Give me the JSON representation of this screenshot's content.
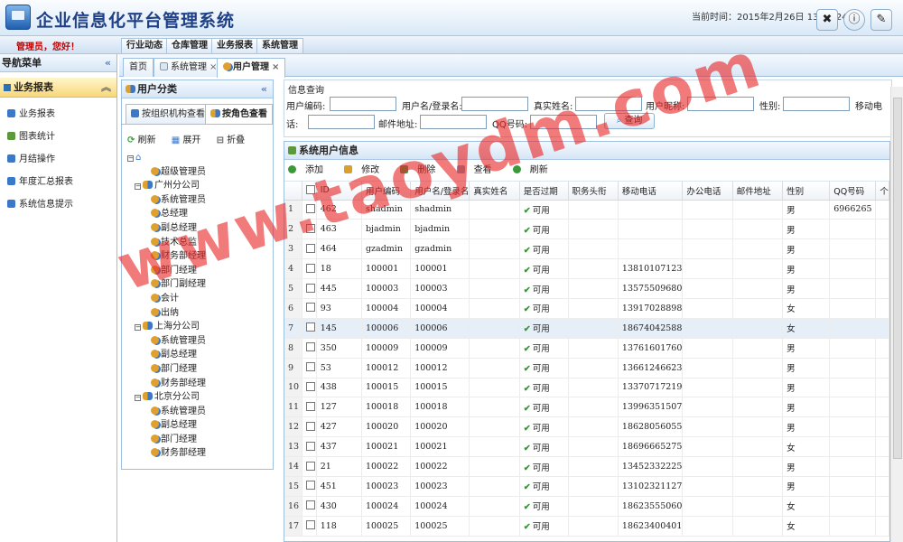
{
  "header": {
    "title": "企业信息化平台管理系统",
    "time_label": "当前时间：2015年2月26日 13:00:24",
    "buttons": [
      {
        "icon": "tools-icon",
        "glyph": "✖"
      },
      {
        "icon": "help-icon",
        "glyph": "ⓘ"
      },
      {
        "icon": "logout-icon",
        "glyph": "✎"
      }
    ]
  },
  "topnav": {
    "welcome": "管理员，您好！",
    "items": [
      "行业动态",
      "仓库管理",
      "业务报表",
      "系统管理"
    ]
  },
  "sidebar": {
    "title": "导航菜单",
    "section": "业务报表",
    "items": [
      "业务报表",
      "图表统计",
      "月结操作",
      "年度汇总报表",
      "系统信息提示"
    ]
  },
  "tabs": [
    {
      "label": "首页"
    },
    {
      "label": "系统管理",
      "close": "×"
    },
    {
      "label": "用户管理",
      "close": "×"
    }
  ],
  "user_panel": {
    "title": "用户分类",
    "tab_org": "按组织机构查看",
    "tab_role": "按角色查看",
    "toolbar": [
      "刷新",
      "展开",
      "折叠"
    ],
    "tree": {
      "root_icon": "⌂",
      "items": [
        {
          "label": "超级管理员",
          "level": 1,
          "type": "user"
        },
        {
          "label": "广州分公司",
          "level": 0,
          "type": "group"
        },
        {
          "label": "系统管理员",
          "level": 1,
          "type": "user"
        },
        {
          "label": "总经理",
          "level": 1,
          "type": "user"
        },
        {
          "label": "副总经理",
          "level": 1,
          "type": "user"
        },
        {
          "label": "技术总监",
          "level": 1,
          "type": "user"
        },
        {
          "label": "财务部经理",
          "level": 1,
          "type": "user"
        },
        {
          "label": "部门经理",
          "level": 1,
          "type": "user"
        },
        {
          "label": "部门副经理",
          "level": 1,
          "type": "user"
        },
        {
          "label": "会计",
          "level": 1,
          "type": "user"
        },
        {
          "label": "出纳",
          "level": 1,
          "type": "user"
        },
        {
          "label": "上海分公司",
          "level": 0,
          "type": "group"
        },
        {
          "label": "系统管理员",
          "level": 1,
          "type": "user"
        },
        {
          "label": "副总经理",
          "level": 1,
          "type": "user"
        },
        {
          "label": "部门经理",
          "level": 1,
          "type": "user"
        },
        {
          "label": "财务部经理",
          "level": 1,
          "type": "user"
        },
        {
          "label": "北京分公司",
          "level": 0,
          "type": "group"
        },
        {
          "label": "系统管理员",
          "level": 1,
          "type": "user"
        },
        {
          "label": "副总经理",
          "level": 1,
          "type": "user"
        },
        {
          "label": "部门经理",
          "level": 1,
          "type": "user"
        },
        {
          "label": "财务部经理",
          "level": 1,
          "type": "user"
        }
      ]
    }
  },
  "query": {
    "legend": "信息查询",
    "labels": {
      "user_code": "用户编码:",
      "login_name": "用户名/登录名:",
      "real_name": "真实姓名:",
      "nickname": "用户昵称:",
      "gender": "性别:",
      "mobile_a": "移动电",
      "mobile_b": "话:",
      "email": "邮件地址:",
      "qq": "QQ号码:"
    },
    "search_button": "查询"
  },
  "grid": {
    "title": "系统用户信息",
    "toolbar": [
      "添加",
      "修改",
      "删除",
      "查看",
      "刷新"
    ],
    "columns": [
      "ID",
      "用户编码",
      "用户名/登录名",
      "真实姓名",
      "是否过期",
      "职务头衔",
      "移动电话",
      "办公电话",
      "邮件地址",
      "性别",
      "QQ号码",
      "个"
    ],
    "status_text": "可用",
    "rows": [
      {
        "n": "1",
        "id": "462",
        "code": "shadmin",
        "login": "shadmin",
        "mobile": "",
        "gender": "男",
        "qq": "6966265"
      },
      {
        "n": "2",
        "id": "463",
        "code": "bjadmin",
        "login": "bjadmin",
        "mobile": "",
        "gender": "男",
        "qq": ""
      },
      {
        "n": "3",
        "id": "464",
        "code": "gzadmin",
        "login": "gzadmin",
        "mobile": "",
        "gender": "男",
        "qq": ""
      },
      {
        "n": "4",
        "id": "18",
        "code": "100001",
        "login": "100001",
        "mobile": "13810107123",
        "gender": "男",
        "qq": ""
      },
      {
        "n": "5",
        "id": "445",
        "code": "100003",
        "login": "100003",
        "mobile": "13575509680",
        "gender": "男",
        "qq": ""
      },
      {
        "n": "6",
        "id": "93",
        "code": "100004",
        "login": "100004",
        "mobile": "13917028898",
        "gender": "女",
        "qq": ""
      },
      {
        "n": "7",
        "id": "145",
        "code": "100006",
        "login": "100006",
        "mobile": "18674042588",
        "gender": "女",
        "qq": ""
      },
      {
        "n": "8",
        "id": "350",
        "code": "100009",
        "login": "100009",
        "mobile": "13761601760",
        "gender": "男",
        "qq": ""
      },
      {
        "n": "9",
        "id": "53",
        "code": "100012",
        "login": "100012",
        "mobile": "13661246623",
        "gender": "男",
        "qq": ""
      },
      {
        "n": "10",
        "id": "438",
        "code": "100015",
        "login": "100015",
        "mobile": "13370717219",
        "gender": "男",
        "qq": ""
      },
      {
        "n": "11",
        "id": "127",
        "code": "100018",
        "login": "100018",
        "mobile": "13996351507",
        "gender": "男",
        "qq": ""
      },
      {
        "n": "12",
        "id": "427",
        "code": "100020",
        "login": "100020",
        "mobile": "18628056055",
        "gender": "男",
        "qq": ""
      },
      {
        "n": "13",
        "id": "437",
        "code": "100021",
        "login": "100021",
        "mobile": "18696665275",
        "gender": "女",
        "qq": ""
      },
      {
        "n": "14",
        "id": "21",
        "code": "100022",
        "login": "100022",
        "mobile": "13452332225",
        "gender": "男",
        "qq": ""
      },
      {
        "n": "15",
        "id": "451",
        "code": "100023",
        "login": "100023",
        "mobile": "13102321127",
        "gender": "男",
        "qq": ""
      },
      {
        "n": "16",
        "id": "430",
        "code": "100024",
        "login": "100024",
        "mobile": "18623555060",
        "gender": "女",
        "qq": ""
      },
      {
        "n": "17",
        "id": "118",
        "code": "100025",
        "login": "100025",
        "mobile": "18623400401",
        "gender": "女",
        "qq": ""
      }
    ]
  },
  "watermark": "www.taoydm.com"
}
